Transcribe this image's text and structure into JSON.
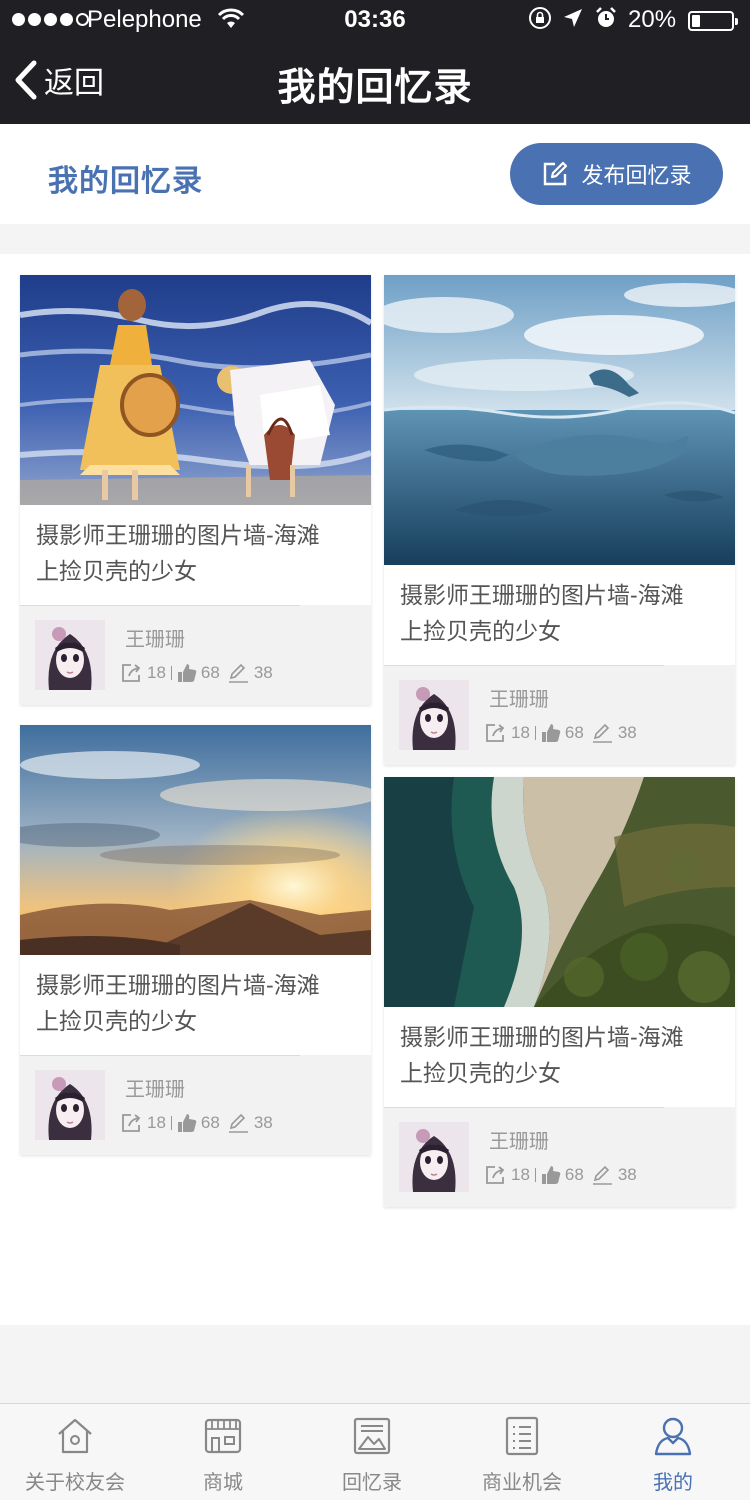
{
  "status_bar": {
    "carrier": "Pelephone",
    "time": "03:36",
    "battery": "20%",
    "battery_level": 0.2
  },
  "nav": {
    "back_label": "返回",
    "title": "我的回忆录"
  },
  "header": {
    "section_title": "我的回忆录",
    "publish_label": "发布回忆录"
  },
  "cards": [
    {
      "image": "painting-girls-beach",
      "caption_line1": "摄影师王珊珊的图片墙-海滩",
      "caption_line2": "上捡贝壳的少女",
      "author": "王珊珊",
      "shares": "18",
      "likes": "68",
      "comments": "38"
    },
    {
      "image": "dolphins-ocean",
      "caption_line1": "摄影师王珊珊的图片墙-海滩",
      "caption_line2": "上捡贝壳的少女",
      "author": "王珊珊",
      "shares": "18",
      "likes": "68",
      "comments": "38"
    },
    {
      "image": "sunset-mountains",
      "caption_line1": "摄影师王珊珊的图片墙-海滩",
      "caption_line2": "上捡贝壳的少女",
      "author": "王珊珊",
      "shares": "18",
      "likes": "68",
      "comments": "38"
    },
    {
      "image": "aerial-coastline",
      "caption_line1": "摄影师王珊珊的图片墙-海滩",
      "caption_line2": "上捡贝壳的少女",
      "author": "王珊珊",
      "shares": "18",
      "likes": "68",
      "comments": "38"
    }
  ],
  "tabs": [
    {
      "label": "关于校友会",
      "icon": "home-icon"
    },
    {
      "label": "商城",
      "icon": "shop-icon"
    },
    {
      "label": "回忆录",
      "icon": "gallery-icon"
    },
    {
      "label": "商业机会",
      "icon": "document-icon"
    },
    {
      "label": "我的",
      "icon": "user-icon",
      "active": true
    }
  ],
  "colors": {
    "accent": "#4a72b2",
    "topbar": "#201f23"
  }
}
